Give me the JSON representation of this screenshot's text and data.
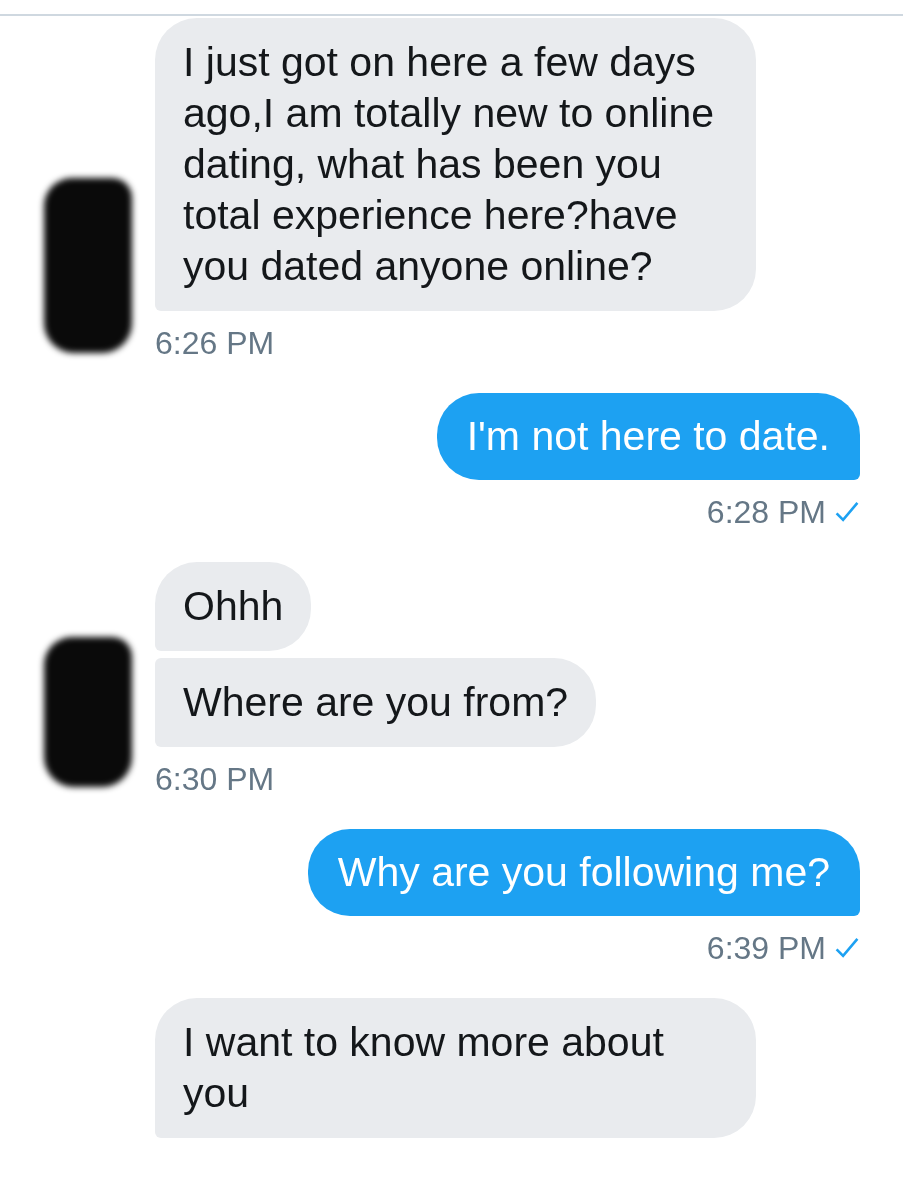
{
  "conversation": [
    {
      "kind": "incoming",
      "avatar": true,
      "messages": [
        "I just got on here a few days ago,I am totally new to online dating, what has been you total experience here?have you dated anyone online?"
      ],
      "time": "6:26 PM"
    },
    {
      "kind": "outgoing",
      "messages": [
        "I'm not here to date."
      ],
      "time": "6:28 PM",
      "read": true
    },
    {
      "kind": "incoming",
      "avatar": true,
      "messages": [
        "Ohhh",
        "Where are you from?"
      ],
      "time": "6:30 PM"
    },
    {
      "kind": "outgoing",
      "messages": [
        "Why are you following me?"
      ],
      "time": "6:39 PM",
      "read": true
    },
    {
      "kind": "incoming",
      "avatar": false,
      "messages": [
        "I want to know more about you"
      ]
    }
  ]
}
